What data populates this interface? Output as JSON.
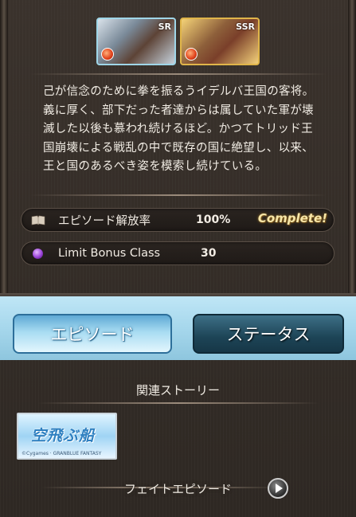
{
  "portraits": [
    {
      "rarity": "SR",
      "element_icon": "fire-orb-icon"
    },
    {
      "rarity": "SSR",
      "element_icon": "fire-orb-icon"
    }
  ],
  "profile_text": "己が信念のために拳を振るうイデルバ王国の客将。義に厚く、部下だった者達からは属していた軍が壊滅した以後も慕われ続けるほど。かつてトリッド王国崩壊による戦乱の中で既存の国に絶望し、以来、王と国のあるべき姿を模索し続けている。",
  "episode_row": {
    "icon": "book-icon",
    "label": "エピソード解放率",
    "value": "100%",
    "badge": "Complete!",
    "progress": 1.0
  },
  "limit_row": {
    "icon": "purple-orb-icon",
    "label": "Limit Bonus Class",
    "value": "30"
  },
  "tabs": [
    {
      "label": "エピソード",
      "active": true
    },
    {
      "label": "ステータス",
      "active": false
    }
  ],
  "related": {
    "title": "関連ストーリー",
    "banner_title": "空飛ぶ船",
    "banner_small": "©Cygames · GRANBLUE FANTASY"
  },
  "fate": {
    "label": "フェイトエピソード",
    "icon": "play-icon"
  },
  "colors": {
    "tab_active": "#a8dcf2",
    "tab_inactive": "#1d4456",
    "complete_badge": "#f7e6a8",
    "limit_orb": "#9a42d8"
  }
}
